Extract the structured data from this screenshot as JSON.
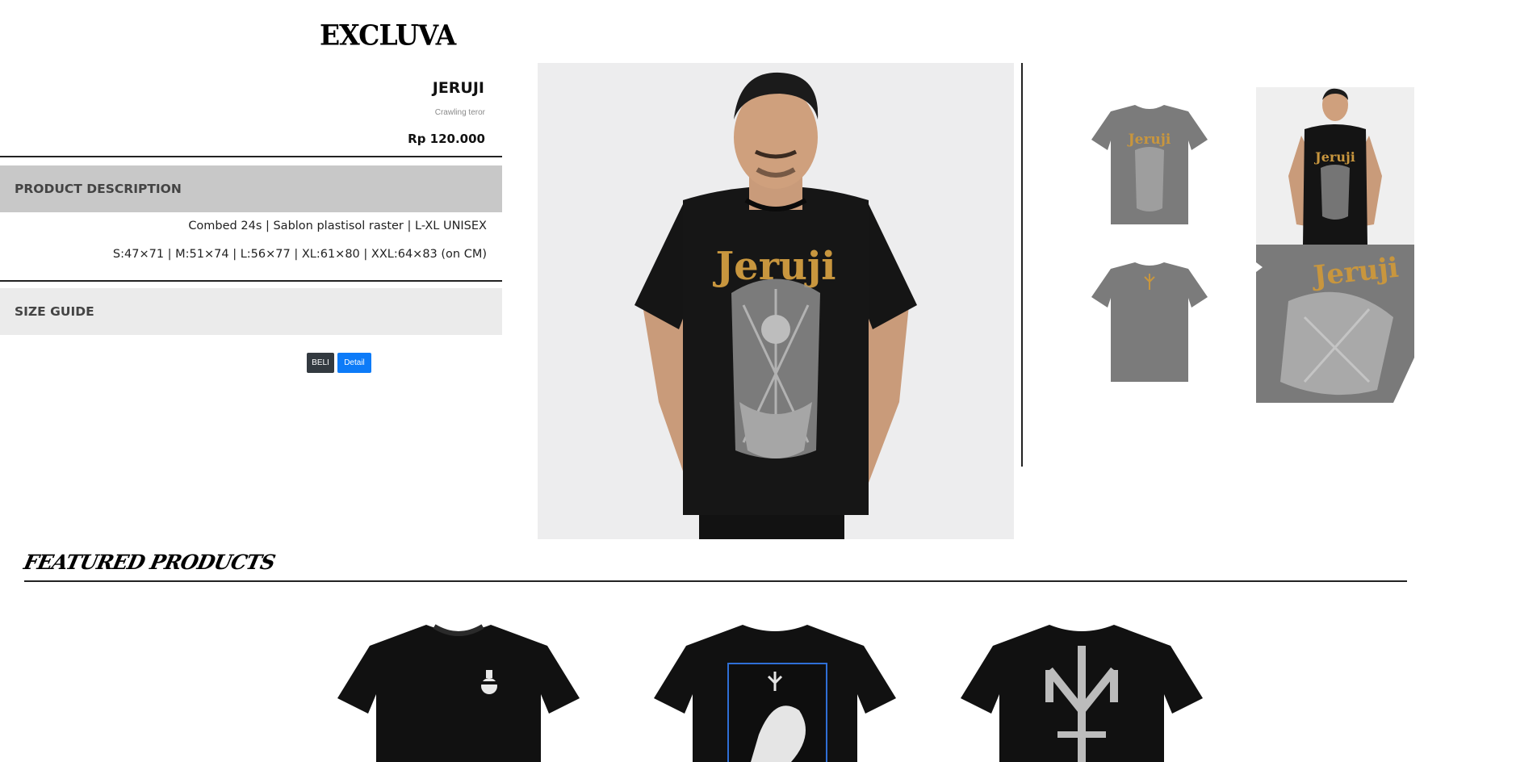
{
  "brand": {
    "logo_text": "EXCLUVA"
  },
  "product": {
    "name": "JERUJI",
    "subtitle": "Crawling teror",
    "price": "Rp 120.000",
    "description_header": "PRODUCT DESCRIPTION",
    "description_lines": [
      "Combed 24s | Sablon plastisol raster | L-XL UNISEX",
      "S:47×71 | M:51×74 | L:56×77 | XL:61×80 | XXL:64×83 (on CM)"
    ],
    "size_guide_header": "SIZE GUIDE",
    "print_text": "Jeruji"
  },
  "actions": {
    "buy_label": "BELI",
    "detail_label": "Detail"
  },
  "gallery": {
    "thumbnails": [
      "tshirt-front-gray",
      "model-wearing-tshirt",
      "tshirt-back-gray",
      "print-closeup"
    ]
  },
  "featured": {
    "title": "FEATURED PRODUCTS",
    "items": [
      "black-tshirt-crown-logo",
      "black-tshirt-blue-frame-print",
      "black-tshirt-trident-print"
    ]
  },
  "colors": {
    "accent_blue": "#0d7bf8",
    "buy_button": "#333a40",
    "desc_band": "#c8c8c8",
    "size_band": "#ebebeb",
    "print_gold": "#c8963e"
  }
}
